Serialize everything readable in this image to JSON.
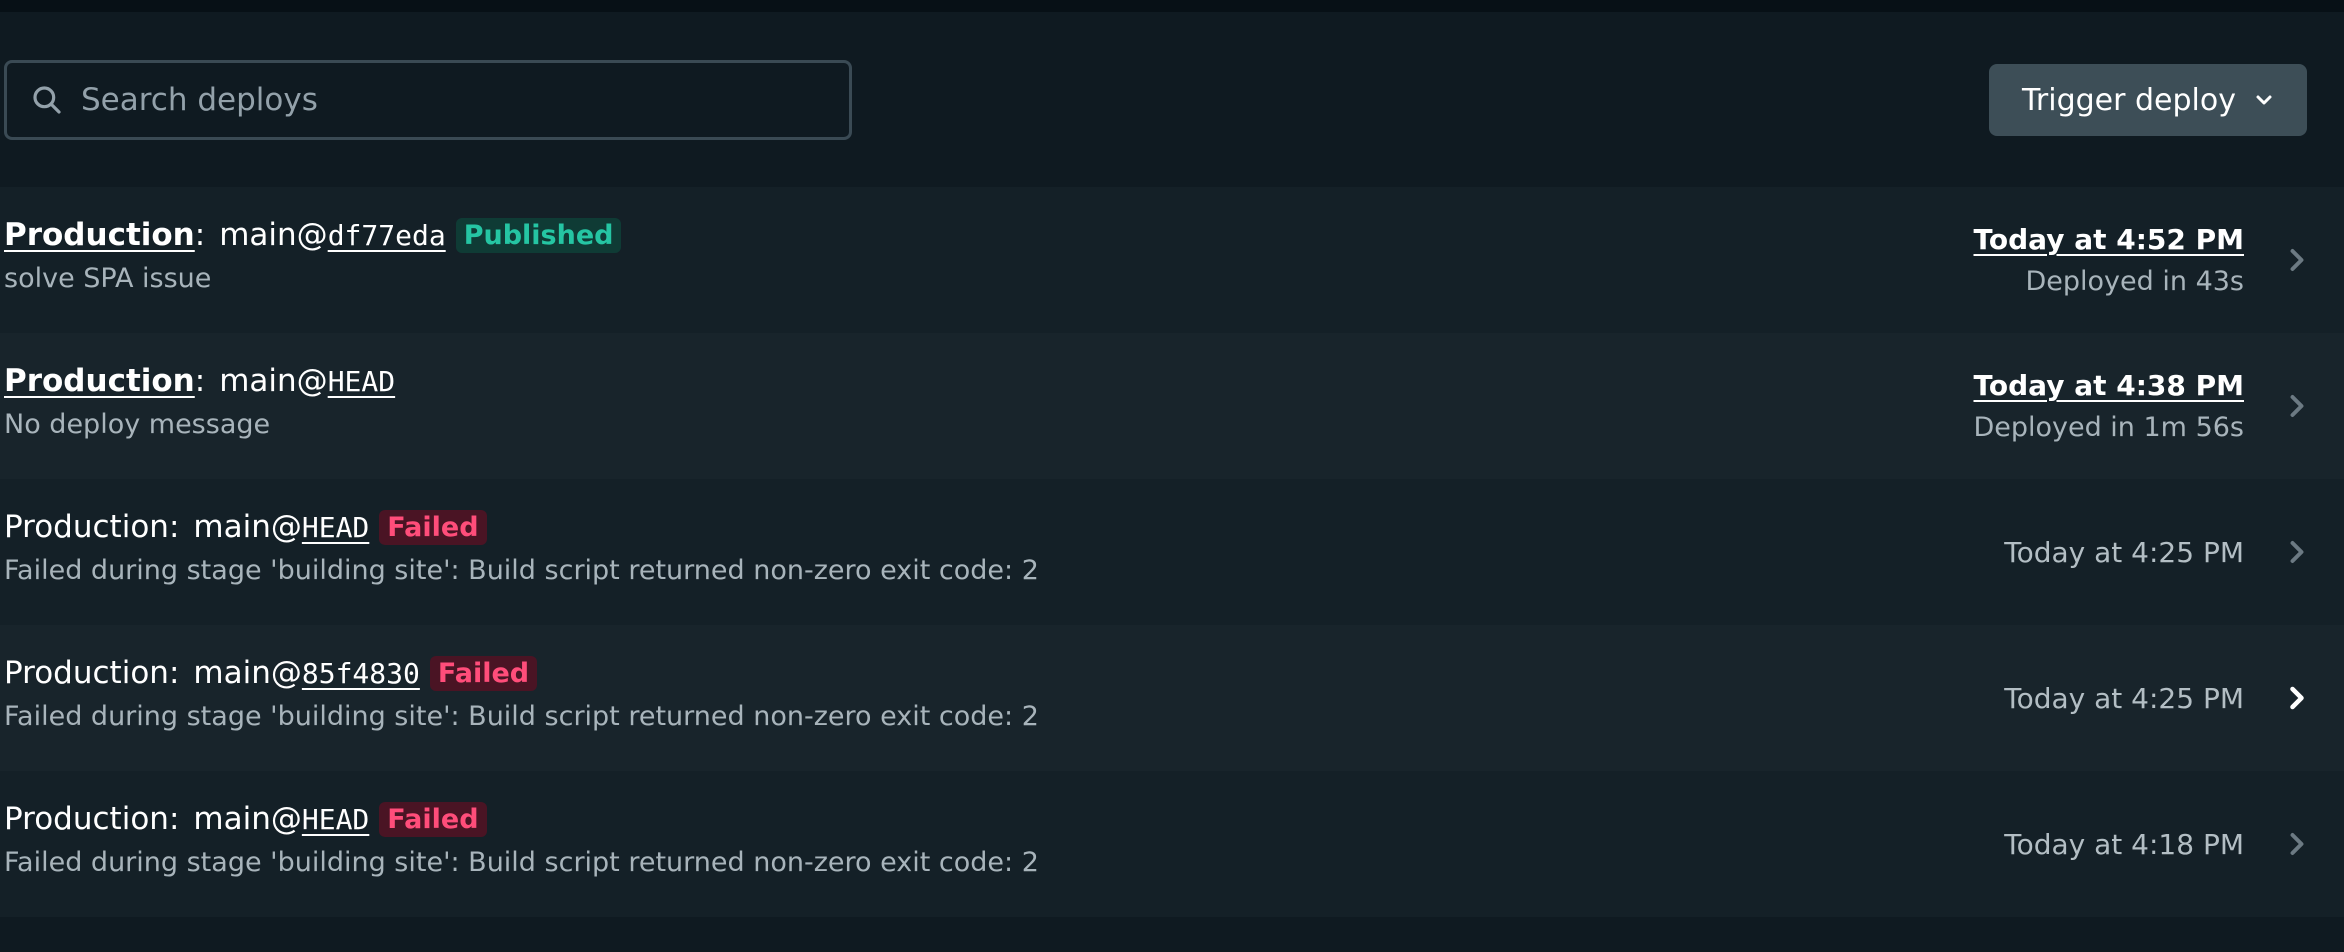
{
  "search": {
    "placeholder": "Search deploys",
    "value": ""
  },
  "trigger": {
    "label": "Trigger deploy"
  },
  "colors": {
    "published": "#25c5a3",
    "failed": "#ff4d7a",
    "background": "#0f1a21"
  },
  "deploys": [
    {
      "context": "Production",
      "branch": "main@",
      "commit": "df77eda",
      "status": "Published",
      "message": "solve SPA issue",
      "time": "Today at 4:52 PM",
      "duration": "Deployed in 43s"
    },
    {
      "context": "Production",
      "branch": "main@",
      "commit": "HEAD",
      "status": "",
      "message": "No deploy message",
      "time": "Today at 4:38 PM",
      "duration": "Deployed in 1m 56s"
    },
    {
      "context": "Production",
      "branch": "main@",
      "commit": "HEAD",
      "status": "Failed",
      "message": "Failed during stage 'building site': Build script returned non-zero exit code: 2",
      "time": "Today at 4:25 PM",
      "duration": ""
    },
    {
      "context": "Production",
      "branch": "main@",
      "commit": "85f4830",
      "status": "Failed",
      "message": "Failed during stage 'building site': Build script returned non-zero exit code: 2",
      "time": "Today at 4:25 PM",
      "duration": ""
    },
    {
      "context": "Production",
      "branch": "main@",
      "commit": "HEAD",
      "status": "Failed",
      "message": "Failed during stage 'building site': Build script returned non-zero exit code: 2",
      "time": "Today at 4:18 PM",
      "duration": ""
    }
  ],
  "separator": ":",
  "icons": {
    "search": "search-icon",
    "trigger_caret": "chevron-down-icon",
    "row_arrow": "chevron-right-icon"
  }
}
